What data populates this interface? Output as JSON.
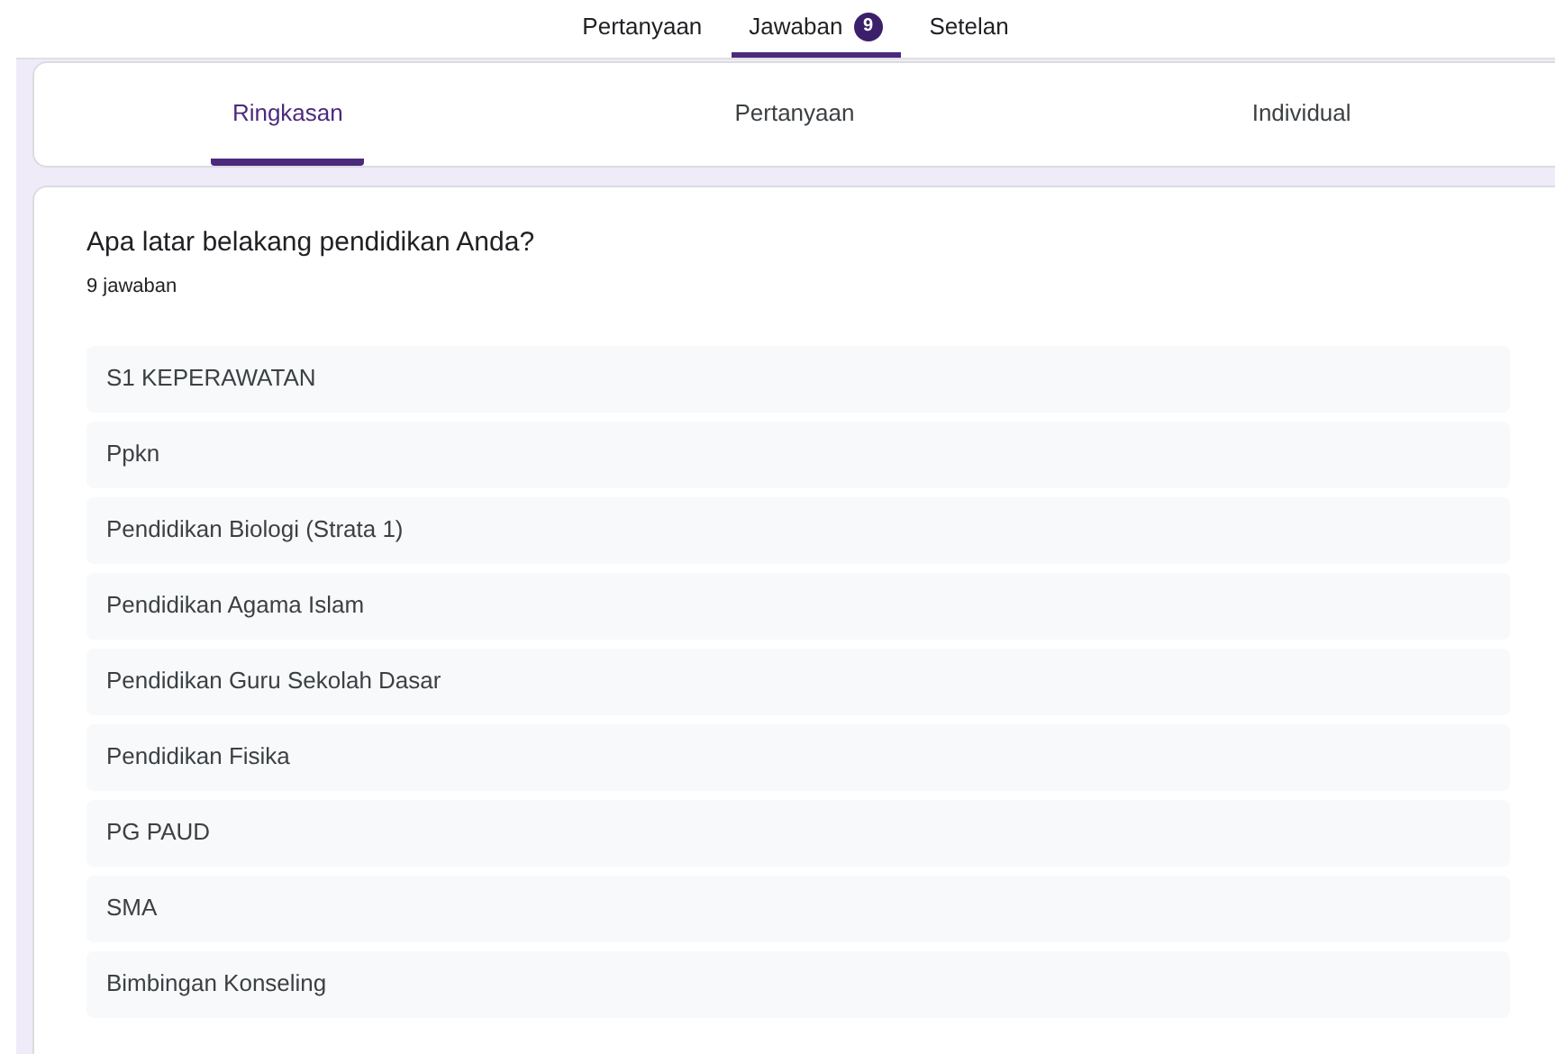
{
  "top_tabs": [
    {
      "label": "Pertanyaan",
      "selected": false
    },
    {
      "label": "Jawaban",
      "selected": true,
      "badge": "9"
    },
    {
      "label": "Setelan",
      "selected": false
    }
  ],
  "sub_tabs": [
    {
      "label": "Ringkasan",
      "selected": true
    },
    {
      "label": "Pertanyaan",
      "selected": false
    },
    {
      "label": "Individual",
      "selected": false
    }
  ],
  "question": {
    "title": "Apa latar belakang pendidikan Anda?",
    "count": "9 jawaban",
    "answers": [
      "S1 KEPERAWATAN",
      "Ppkn",
      "Pendidikan Biologi (Strata 1)",
      "Pendidikan Agama Islam",
      "Pendidikan Guru Sekolah Dasar",
      "Pendidikan Fisika",
      "PG PAUD",
      "SMA",
      "Bimbingan Konseling"
    ]
  }
}
